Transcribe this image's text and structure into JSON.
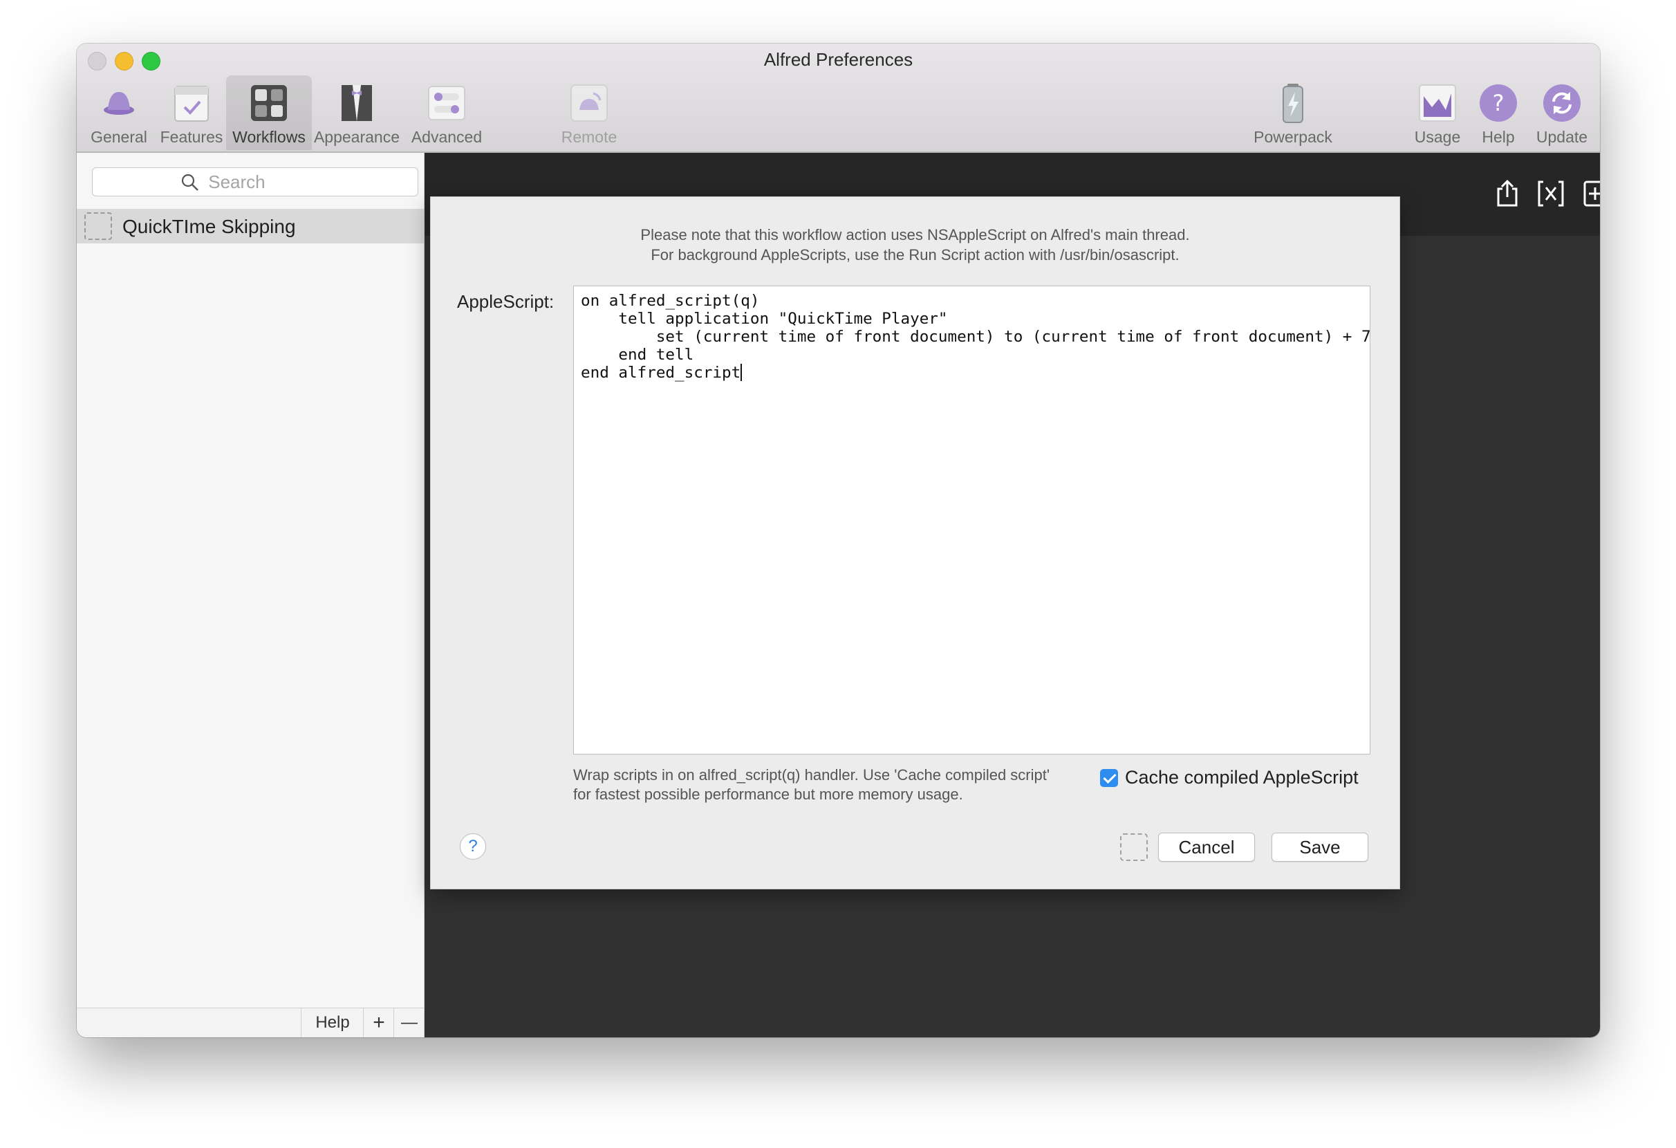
{
  "window": {
    "title": "Alfred Preferences"
  },
  "toolbar": {
    "general": "General",
    "features": "Features",
    "workflows": "Workflows",
    "appearance": "Appearance",
    "advanced": "Advanced",
    "remote": "Remote",
    "powerpack": "Powerpack",
    "usage": "Usage",
    "help": "Help",
    "update": "Update"
  },
  "sidebar": {
    "search_placeholder": "Search",
    "workflows": [
      {
        "label": "QuickTIme Skipping",
        "selected": true
      }
    ],
    "footer": {
      "help": "Help",
      "add": "+",
      "remove": "—"
    }
  },
  "sheet": {
    "note_line1": "Please note that this workflow action uses NSAppleScript on Alfred's main thread.",
    "note_line2": "For background AppleScripts, use the Run Script action with /usr/bin/osascript.",
    "field_label": "AppleScript:",
    "script": "on alfred_script(q)\n    tell application \"QuickTime Player\"\n        set (current time of front document) to (current time of front document) + 7\n    end tell\nend alfred_script",
    "hint": "Wrap scripts in on alfred_script(q) handler. Use 'Cache compiled script' for fastest possible performance but more memory usage.",
    "cache_label": "Cache compiled AppleScript",
    "cache_checked": true,
    "help_glyph": "?",
    "cancel": "Cancel",
    "save": "Save"
  },
  "colors": {
    "accent": "#2d8cf0",
    "canvas": "#313131",
    "toolbar_icon_purple": "#a58bd0"
  },
  "icons": {
    "general": "hat-icon",
    "features": "checklist-icon",
    "workflows": "workflow-grid-icon",
    "appearance": "tuxedo-icon",
    "advanced": "toggles-icon",
    "remote": "remote-icon",
    "powerpack": "battery-bolt-icon",
    "usage": "chart-icon",
    "help": "question-icon",
    "update": "refresh-icon"
  }
}
